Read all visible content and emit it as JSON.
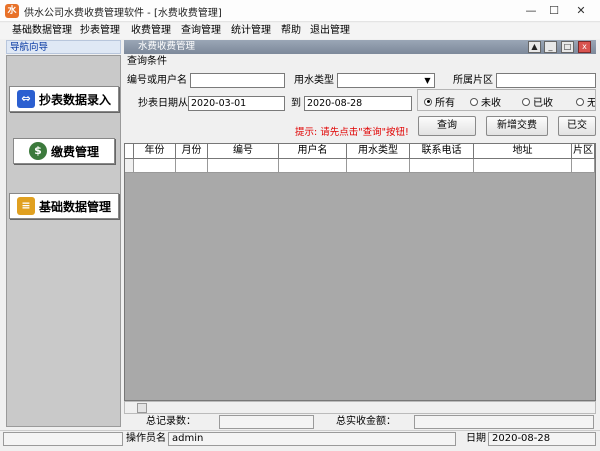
{
  "window": {
    "title": "供水公司水费收费管理软件  - [水费收费管理]",
    "app_icon": "水",
    "min_glyph": "—",
    "max_glyph": "☐",
    "close_glyph": "✕"
  },
  "menu": [
    "基础数据管理",
    "抄表管理",
    "收费管理",
    "查询管理",
    "统计管理",
    "帮助",
    "退出管理"
  ],
  "sidebar": {
    "header": "导航向导",
    "items": [
      {
        "label": "抄表数据录入",
        "icon": "meter-reading-icon"
      },
      {
        "label": "缴费管理",
        "icon": "money-bag-icon"
      },
      {
        "label": "基础数据管理",
        "icon": "data-settings-icon"
      }
    ]
  },
  "child_window": {
    "title": "水费收费管理",
    "btn_up": "▲",
    "btn_min": "_",
    "btn_max": "□",
    "btn_close": "x"
  },
  "query": {
    "group_label": "查询条件",
    "user_label": "编号或用户名",
    "user_value": "",
    "water_type_label": "用水类型",
    "water_type_value": "",
    "area_label": "所属片区",
    "area_value": "",
    "date_from_label": "抄表日期从",
    "date_from": "2020-03-01",
    "date_to_label": "到",
    "date_to": "2020-08-28",
    "radios": [
      {
        "label": "所有",
        "checked": true
      },
      {
        "label": "未收",
        "checked": false
      },
      {
        "label": "已收",
        "checked": false
      },
      {
        "label": "无",
        "checked": false
      }
    ],
    "hint": "提示: 请先点击\"查询\"按钮!",
    "buttons": [
      "查询",
      "新增交费",
      "已交"
    ]
  },
  "grid": {
    "columns": [
      "",
      "年份",
      "月份",
      "编号",
      "用户名",
      "用水类型",
      "联系电话",
      "地址",
      "片区"
    ]
  },
  "footer": {
    "total_records_label": "总记录数：",
    "total_records_value": "",
    "total_amount_label": "总实收金额：",
    "total_amount_value": "",
    "operator_label": "操作员名",
    "operator_value": "admin",
    "date_label": "日期",
    "date_value": "2020-08-28"
  }
}
